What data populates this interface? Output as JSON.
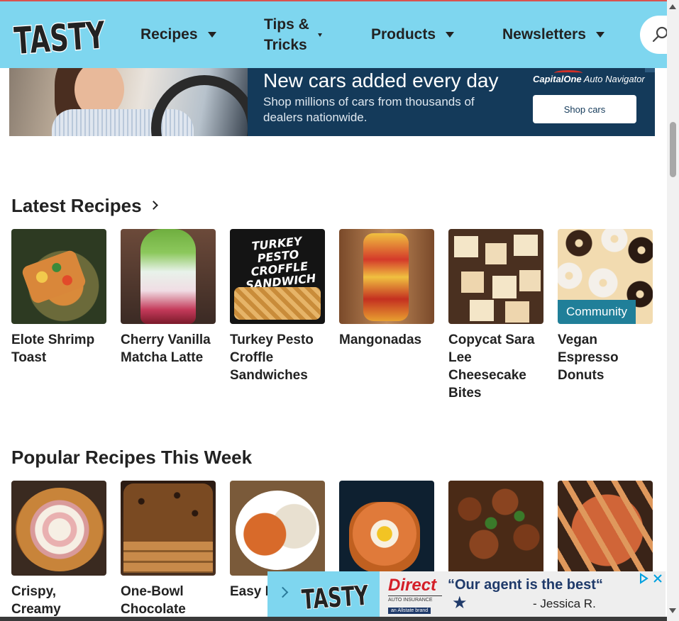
{
  "header": {
    "logo_text": "TASTY",
    "nav": [
      {
        "label": "Recipes"
      },
      {
        "label_line1": "Tips &",
        "label_line2": "Tricks"
      },
      {
        "label": "Products"
      },
      {
        "label": "Newsletters"
      }
    ],
    "search_icon": "search-icon",
    "colors": {
      "header_bg": "#7ed6ef",
      "text": "#222222"
    }
  },
  "top_ad": {
    "headline": "New cars added every day",
    "subtext": "Shop millions of cars from thousands of dealers nationwide.",
    "brand_name": "CapitalOne",
    "brand_product": "Auto Navigator",
    "cta_label": "Shop cars",
    "colors": {
      "panel_bg": "#143a5a"
    }
  },
  "latest": {
    "title": "Latest Recipes",
    "cards": [
      {
        "title": "Elote Shrimp Toast"
      },
      {
        "title": "Cherry Vanilla Matcha Latte"
      },
      {
        "title": "Turkey Pesto Croffle Sandwiches",
        "thumb_text": "TURKEY PESTO CROFFLE SANDWICH"
      },
      {
        "title": "Mangonadas"
      },
      {
        "title": "Copycat Sara Lee Cheesecake Bites"
      },
      {
        "title": "Vegan Espresso Donuts",
        "badge": "Community"
      }
    ]
  },
  "popular": {
    "title": "Popular Recipes This Week",
    "cards": [
      {
        "title": "Crispy, Creamy"
      },
      {
        "title": "One-Bowl Chocolate"
      },
      {
        "title": "Easy I Chick"
      },
      {
        "title": ""
      },
      {
        "title": ""
      },
      {
        "title": ""
      }
    ]
  },
  "bottom_ad": {
    "logo_text": "TASTY",
    "brand_name": "Direct",
    "brand_sub": "AUTO INSURANCE",
    "brand_sub2": "an Allstate brand",
    "quote": "“Our agent is the best“",
    "author": "- Jessica R.",
    "info_icon": "ad-info-icon",
    "close_icon": "close-icon"
  },
  "accent_colors": {
    "community_badge": "#207f99",
    "header": "#7ed6ef",
    "ad_close": "#00a0e0"
  }
}
